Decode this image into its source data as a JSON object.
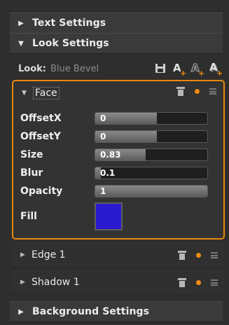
{
  "sections": {
    "text_settings": "Text Settings",
    "look_settings": "Look Settings",
    "background_settings": "Background Settings"
  },
  "look": {
    "label": "Look:",
    "value": "Blue Bevel",
    "icons": [
      "save-icon",
      "add-text-icon",
      "add-outline-text-icon",
      "add-shadow-text-icon"
    ]
  },
  "face": {
    "title": "Face",
    "properties": [
      {
        "label": "OffsetX",
        "value": "0",
        "fill_fraction": 0.55
      },
      {
        "label": "OffsetY",
        "value": "0",
        "fill_fraction": 0.55
      },
      {
        "label": "Size",
        "value": "0.83",
        "fill_fraction": 0.45
      },
      {
        "label": "Blur",
        "value": "0.1",
        "fill_fraction": 0.05
      },
      {
        "label": "Opacity",
        "value": "1",
        "fill_fraction": 1.0
      }
    ],
    "fill_label": "Fill",
    "fill_color": "#2a1ad0"
  },
  "sub_items": [
    {
      "title": "Edge 1"
    },
    {
      "title": "Shadow 1"
    }
  ],
  "colors": {
    "accent": "#e88a0c",
    "dot": "#f28c10"
  }
}
